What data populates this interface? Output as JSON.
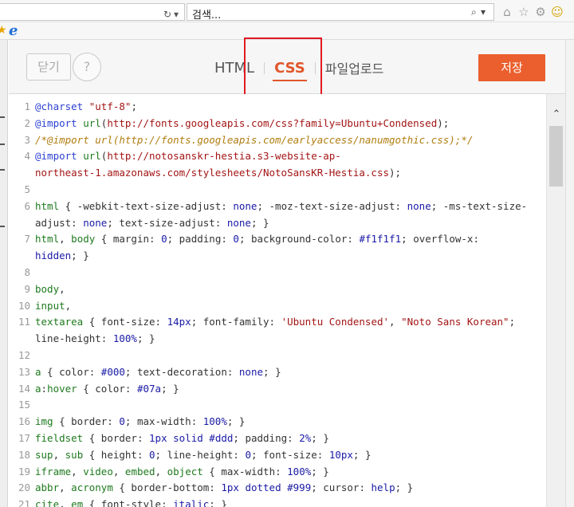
{
  "browser": {
    "refresh_icon": "↻",
    "dropdown_icon": "▾",
    "search_placeholder": "검색...",
    "search_icon": "⌕",
    "icons": [
      "home-icon",
      "star-icon",
      "gear-icon",
      "smiley-icon"
    ]
  },
  "editor": {
    "close_label": "닫기",
    "help_label": "?",
    "tabs": [
      {
        "label": "HTML",
        "active": false
      },
      {
        "label": "CSS",
        "active": true
      },
      {
        "label": "파일업로드",
        "active": false
      }
    ],
    "save_label": "저장",
    "accent_color": "#ea5f2d",
    "highlight_color": "#e11b22"
  },
  "code": {
    "lines": [
      {
        "n": "1",
        "parts": [
          [
            "at",
            "@charset"
          ],
          [
            "txt",
            " "
          ],
          [
            "str",
            "\"utf-8\""
          ],
          [
            "txt",
            ";"
          ]
        ]
      },
      {
        "n": "2",
        "parts": [
          [
            "at",
            "@import"
          ],
          [
            "txt",
            " "
          ],
          [
            "kw",
            "url"
          ],
          [
            "txt",
            "("
          ],
          [
            "url",
            "http://fonts.googleapis.com/css?family=Ubuntu+Condensed"
          ],
          [
            "txt",
            ");"
          ]
        ]
      },
      {
        "n": "3",
        "parts": [
          [
            "com",
            "/*@import url(http://fonts.googleapis.com/earlyaccess/nanumgothic.css);*/"
          ]
        ]
      },
      {
        "n": "4",
        "parts": [
          [
            "at",
            "@import"
          ],
          [
            "txt",
            " "
          ],
          [
            "kw",
            "url"
          ],
          [
            "txt",
            "("
          ],
          [
            "url",
            "http://notosanskr-hestia.s3-website-ap-"
          ]
        ]
      },
      {
        "n": "",
        "parts": [
          [
            "url",
            "northeast-1.amazonaws.com/stylesheets/NotoSansKR-Hestia.css"
          ],
          [
            "txt",
            ");"
          ]
        ]
      },
      {
        "n": "5",
        "parts": []
      },
      {
        "n": "6",
        "parts": [
          [
            "kw",
            "html"
          ],
          [
            "txt",
            " { -webkit-text-size-adjust: "
          ],
          [
            "val",
            "none"
          ],
          [
            "txt",
            "; -moz-text-size-adjust: "
          ],
          [
            "val",
            "none"
          ],
          [
            "txt",
            "; -ms-text-size-"
          ]
        ]
      },
      {
        "n": "",
        "parts": [
          [
            "txt",
            "adjust: "
          ],
          [
            "val",
            "none"
          ],
          [
            "txt",
            "; text-size-adjust: "
          ],
          [
            "val",
            "none"
          ],
          [
            "txt",
            "; }"
          ]
        ]
      },
      {
        "n": "7",
        "parts": [
          [
            "kw",
            "html"
          ],
          [
            "txt",
            ", "
          ],
          [
            "kw",
            "body"
          ],
          [
            "txt",
            " { margin: "
          ],
          [
            "num",
            "0"
          ],
          [
            "txt",
            "; padding: "
          ],
          [
            "num",
            "0"
          ],
          [
            "txt",
            "; background-color: "
          ],
          [
            "num",
            "#f1f1f1"
          ],
          [
            "txt",
            "; overflow-x:"
          ]
        ]
      },
      {
        "n": "",
        "parts": [
          [
            "val",
            "hidden"
          ],
          [
            "txt",
            "; }"
          ]
        ]
      },
      {
        "n": "8",
        "parts": []
      },
      {
        "n": "9",
        "parts": [
          [
            "kw",
            "body"
          ],
          [
            "txt",
            ","
          ]
        ]
      },
      {
        "n": "10",
        "parts": [
          [
            "kw",
            "input"
          ],
          [
            "txt",
            ","
          ]
        ]
      },
      {
        "n": "11",
        "parts": [
          [
            "kw",
            "textarea"
          ],
          [
            "txt",
            " { font-size: "
          ],
          [
            "num",
            "14px"
          ],
          [
            "txt",
            "; font-family: "
          ],
          [
            "str",
            "'Ubuntu Condensed'"
          ],
          [
            "txt",
            ", "
          ],
          [
            "str",
            "\"Noto Sans Korean\""
          ],
          [
            "txt",
            ";"
          ]
        ]
      },
      {
        "n": "",
        "parts": [
          [
            "txt",
            "line-height: "
          ],
          [
            "num",
            "100%"
          ],
          [
            "txt",
            "; }"
          ]
        ]
      },
      {
        "n": "12",
        "parts": []
      },
      {
        "n": "13",
        "parts": [
          [
            "kw",
            "a"
          ],
          [
            "txt",
            " { color: "
          ],
          [
            "num",
            "#000"
          ],
          [
            "txt",
            "; text-decoration: "
          ],
          [
            "val",
            "none"
          ],
          [
            "txt",
            "; }"
          ]
        ]
      },
      {
        "n": "14",
        "parts": [
          [
            "kw",
            "a"
          ],
          [
            "txt",
            ":"
          ],
          [
            "kw",
            "hover"
          ],
          [
            "txt",
            " { color: "
          ],
          [
            "num",
            "#07a"
          ],
          [
            "txt",
            "; }"
          ]
        ]
      },
      {
        "n": "15",
        "parts": []
      },
      {
        "n": "16",
        "parts": [
          [
            "kw",
            "img"
          ],
          [
            "txt",
            " { border: "
          ],
          [
            "num",
            "0"
          ],
          [
            "txt",
            "; max-width: "
          ],
          [
            "num",
            "100%"
          ],
          [
            "txt",
            "; }"
          ]
        ]
      },
      {
        "n": "17",
        "parts": [
          [
            "kw",
            "fieldset"
          ],
          [
            "txt",
            " { border: "
          ],
          [
            "num",
            "1px"
          ],
          [
            "txt",
            " "
          ],
          [
            "val",
            "solid"
          ],
          [
            "txt",
            " "
          ],
          [
            "num",
            "#ddd"
          ],
          [
            "txt",
            "; padding: "
          ],
          [
            "num",
            "2%"
          ],
          [
            "txt",
            "; }"
          ]
        ]
      },
      {
        "n": "18",
        "parts": [
          [
            "kw",
            "sup"
          ],
          [
            "txt",
            ", "
          ],
          [
            "kw",
            "sub"
          ],
          [
            "txt",
            " { height: "
          ],
          [
            "num",
            "0"
          ],
          [
            "txt",
            "; line-height: "
          ],
          [
            "num",
            "0"
          ],
          [
            "txt",
            "; font-size: "
          ],
          [
            "num",
            "10px"
          ],
          [
            "txt",
            "; }"
          ]
        ]
      },
      {
        "n": "19",
        "parts": [
          [
            "kw",
            "iframe"
          ],
          [
            "txt",
            ", "
          ],
          [
            "kw",
            "video"
          ],
          [
            "txt",
            ", "
          ],
          [
            "kw",
            "embed"
          ],
          [
            "txt",
            ", "
          ],
          [
            "kw",
            "object"
          ],
          [
            "txt",
            " { max-width: "
          ],
          [
            "num",
            "100%"
          ],
          [
            "txt",
            "; }"
          ]
        ]
      },
      {
        "n": "20",
        "parts": [
          [
            "kw",
            "abbr"
          ],
          [
            "txt",
            ", "
          ],
          [
            "kw",
            "acronym"
          ],
          [
            "txt",
            " { border-bottom: "
          ],
          [
            "num",
            "1px"
          ],
          [
            "txt",
            " "
          ],
          [
            "val",
            "dotted"
          ],
          [
            "txt",
            " "
          ],
          [
            "num",
            "#999"
          ],
          [
            "txt",
            "; cursor: "
          ],
          [
            "val",
            "help"
          ],
          [
            "txt",
            "; }"
          ]
        ]
      },
      {
        "n": "21",
        "parts": [
          [
            "kw",
            "cite"
          ],
          [
            "txt",
            ", "
          ],
          [
            "kw",
            "em"
          ],
          [
            "txt",
            " { font-style: "
          ],
          [
            "val",
            "italic"
          ],
          [
            "txt",
            "; }"
          ]
        ]
      }
    ]
  },
  "scrollbar": {
    "up_arrow": "⌃"
  }
}
